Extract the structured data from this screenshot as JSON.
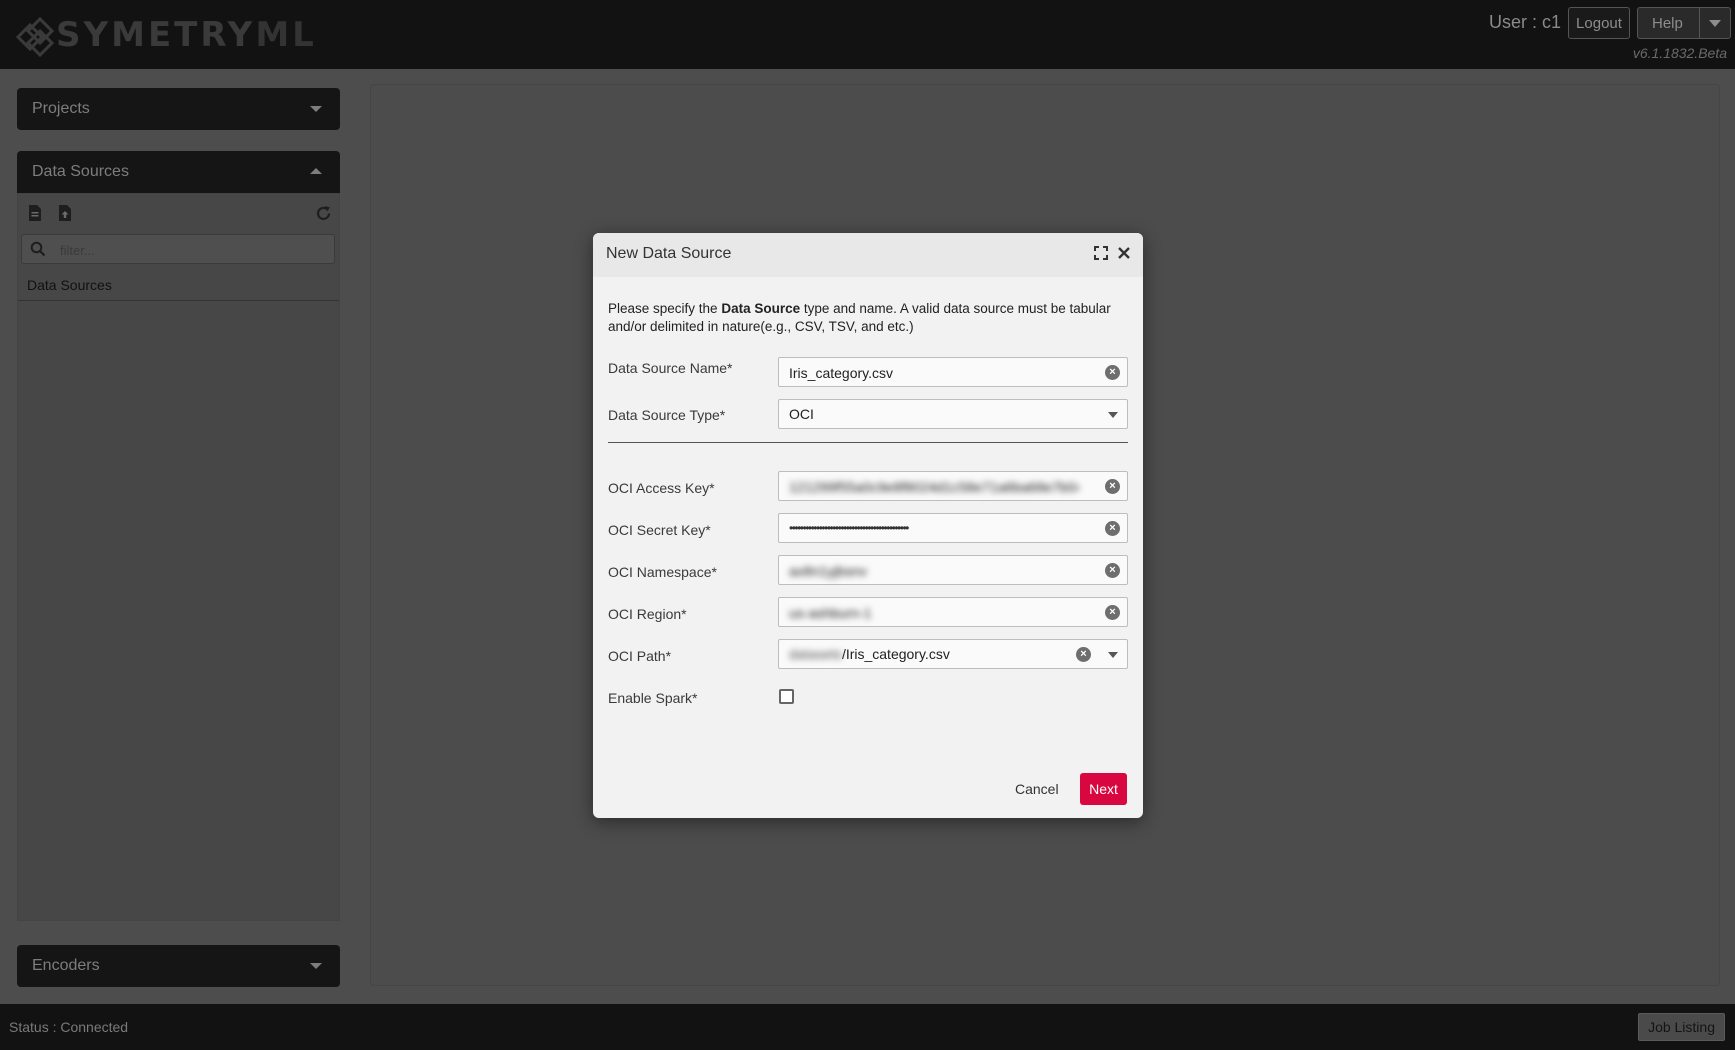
{
  "app": {
    "logo_text": "SYMETRYML",
    "user_label": "User : c1",
    "logout_label": "Logout",
    "help_label": "Help",
    "version": "v6.1.1832.Beta"
  },
  "sidebar": {
    "projects_label": "Projects",
    "datasources_label": "Data Sources",
    "filter_placeholder": "filter...",
    "tree_root_label": "Data Sources",
    "encoders_label": "Encoders"
  },
  "statusbar": {
    "status_text": "Status : Connected",
    "job_listing_label": "Job Listing"
  },
  "modal": {
    "title": "New Data Source",
    "intro_prefix": "Please specify the ",
    "intro_bold": "Data Source",
    "intro_suffix": " type and name. A valid data source must be tabular and/or delimited in nature(e.g., CSV, TSV, and etc.)",
    "fields": {
      "name": {
        "label": "Data Source Name*",
        "value": "Iris_category.csv"
      },
      "type": {
        "label": "Data Source Type*",
        "value": "OCI"
      },
      "access_key": {
        "label": "OCI Access Key*",
        "value": "121299f55a0c9e8f8024d1c58e71a6ba68e7b04"
      },
      "secret_key": {
        "label": "OCI Secret Key*",
        "value": "••••••••••••••••••••••••••••••••••••••••••••"
      },
      "namespace": {
        "label": "OCI Namespace*",
        "value": "ax8n1yjbsnv"
      },
      "region": {
        "label": "OCI Region*",
        "value": "us-ashburn-1"
      },
      "path": {
        "label": "OCI Path*",
        "bucket": "datasets",
        "file": "/Iris_category.csv"
      },
      "spark": {
        "label": "Enable Spark*",
        "checked": false
      }
    },
    "cancel_label": "Cancel",
    "next_label": "Next"
  },
  "colors": {
    "accent": "#d9073f",
    "header_bg": "#121212",
    "backdrop": "#4d4d4d",
    "modal_bg": "#f2f2f2"
  }
}
